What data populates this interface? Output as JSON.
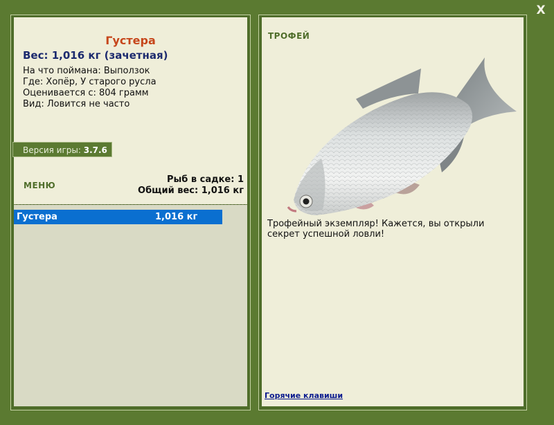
{
  "window": {
    "close_label": "X"
  },
  "fish": {
    "name": "Густера",
    "weight_line": "Вес: 1,016 кг (зачетная)",
    "caught_on": "На что поймана: Выползок",
    "location": "Где: Хопёр, У старого русла",
    "valued_from": "Оценивается с: 804 грамм",
    "rarity": "Вид: Ловится не часто"
  },
  "version": {
    "label": "Версия игры:",
    "value": "3.7.6"
  },
  "menu": {
    "label": "МЕНЮ"
  },
  "keepnet": {
    "count_line": "Рыб в садке: 1",
    "total_line": "Общий вес: 1,016 кг",
    "rows": [
      {
        "name": "Густера",
        "weight": "1,016 кг"
      }
    ]
  },
  "trophy": {
    "badge": "ТРОФЕЙ",
    "description": "Трофейный экземпляр! Кажется, вы открыли секрет успешной ловли!"
  },
  "footer": {
    "hotkeys_link": "Горячие клавиши"
  },
  "colors": {
    "frame": "#5b7a31",
    "paper": "#efeed9",
    "title": "#c6461b",
    "selection": "#0a6fd0"
  }
}
